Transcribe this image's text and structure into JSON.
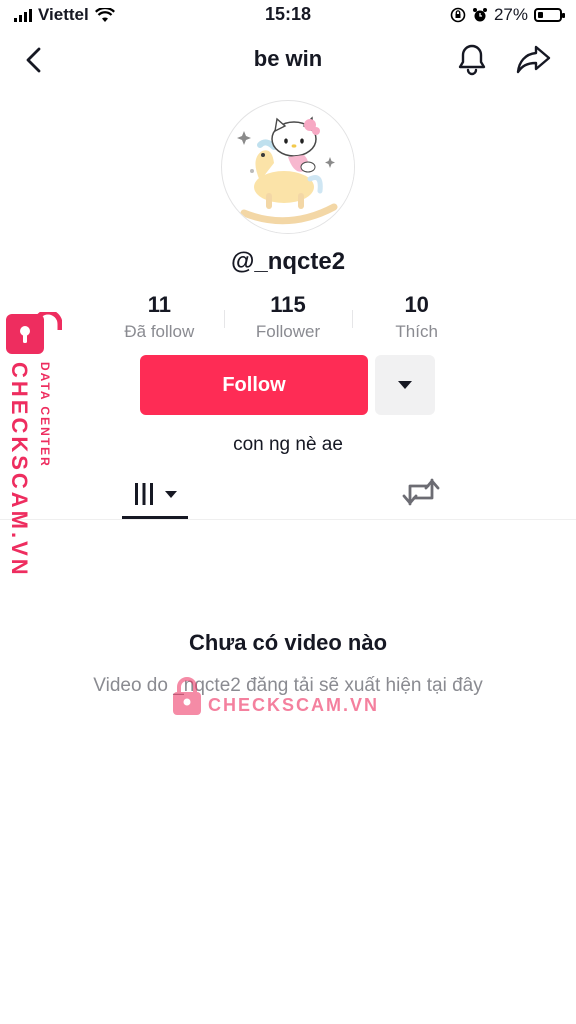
{
  "status_bar": {
    "carrier": "Viettel",
    "time": "15:18",
    "battery_percent": "27%",
    "battery_level": 0.27
  },
  "header": {
    "title": "be win",
    "icons": [
      "back-icon",
      "bell-icon",
      "share-icon"
    ]
  },
  "profile": {
    "username": "@_nqcte2",
    "stats": [
      {
        "value": "11",
        "label": "Đã follow"
      },
      {
        "value": "115",
        "label": "Follower"
      },
      {
        "value": "10",
        "label": "Thích"
      }
    ],
    "follow_label": "Follow",
    "bio": "con ng nè ae"
  },
  "tabs": {
    "icons": [
      "videos-grid-icon",
      "repost-icon"
    ]
  },
  "empty_state": {
    "title": "Chưa có video nào",
    "subtitle": "Video do _nqcte2 đăng tải sẽ xuất hiện tại đây"
  },
  "watermark": {
    "brand": "CHECKSCAM.VN",
    "subtitle": "DATA CENTER"
  },
  "colors": {
    "accent": "#fe2c55",
    "watermark": "#ee2d5f",
    "text": "#161823",
    "muted": "#8a8b91"
  }
}
